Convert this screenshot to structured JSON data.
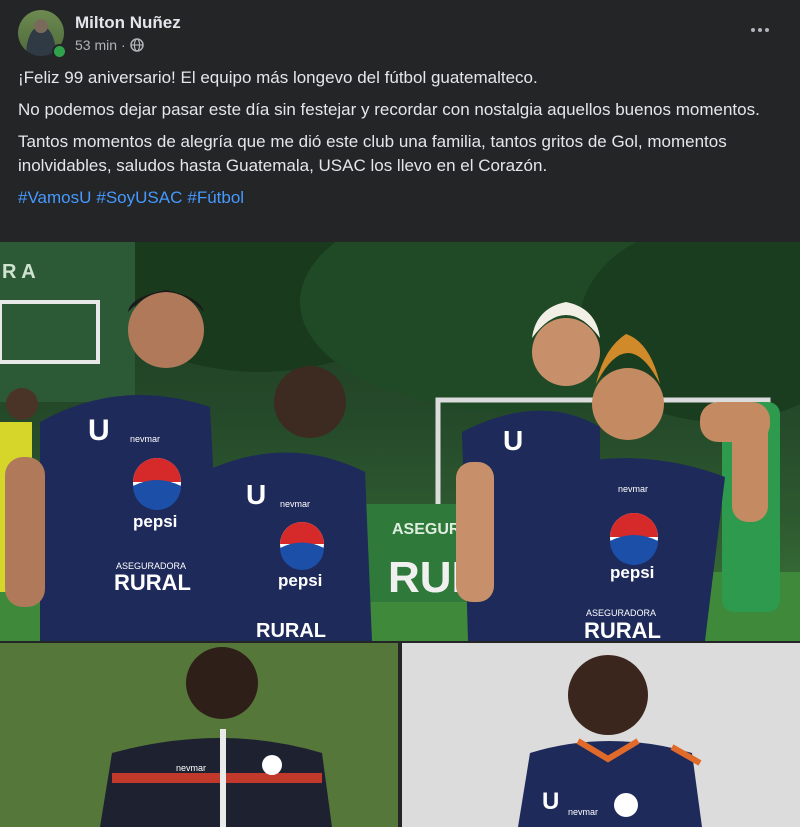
{
  "post": {
    "author": "Milton Nuñez",
    "time": "53 min",
    "separator": "·",
    "privacy_icon": "globe-icon",
    "more_icon": "more-options-icon",
    "paragraphs": [
      "¡Feliz 99 aniversario! El equipo más longevo del fútbol guatemalteco.",
      "No podemos dejar pasar este día sin festejar y recordar con nostalgia aquellos buenos momentos.",
      "Tantos momentos de alegría que me dió este club una familia, tantos gritos de Gol, momentos inolvidables, saludos hasta Guatemala, USAC los llevo en el Corazón."
    ],
    "hashtags": [
      "#VamosU",
      "#SoyUSAC",
      "#Fútbol"
    ]
  },
  "photos": {
    "main": {
      "jersey_letter": "U",
      "sponsor_1": "pepsi",
      "sponsor_2_small": "ASEGURADORA",
      "sponsor_2": "RURAL",
      "kit_brand": "nevmar",
      "banner_small": "ASEGURA",
      "banner": "RURA",
      "sign_left": "R A"
    },
    "sub1": {
      "kit_brand": "nevmar"
    },
    "sub2": {
      "jersey_letter": "U",
      "kit_brand": "nevmar"
    }
  },
  "colors": {
    "background": "#242526",
    "text": "#e4e6eb",
    "secondary_text": "#b0b3b8",
    "hashtag": "#4599ff",
    "jersey": "#1e2a5a",
    "jersey_accent": "#c0392b"
  }
}
